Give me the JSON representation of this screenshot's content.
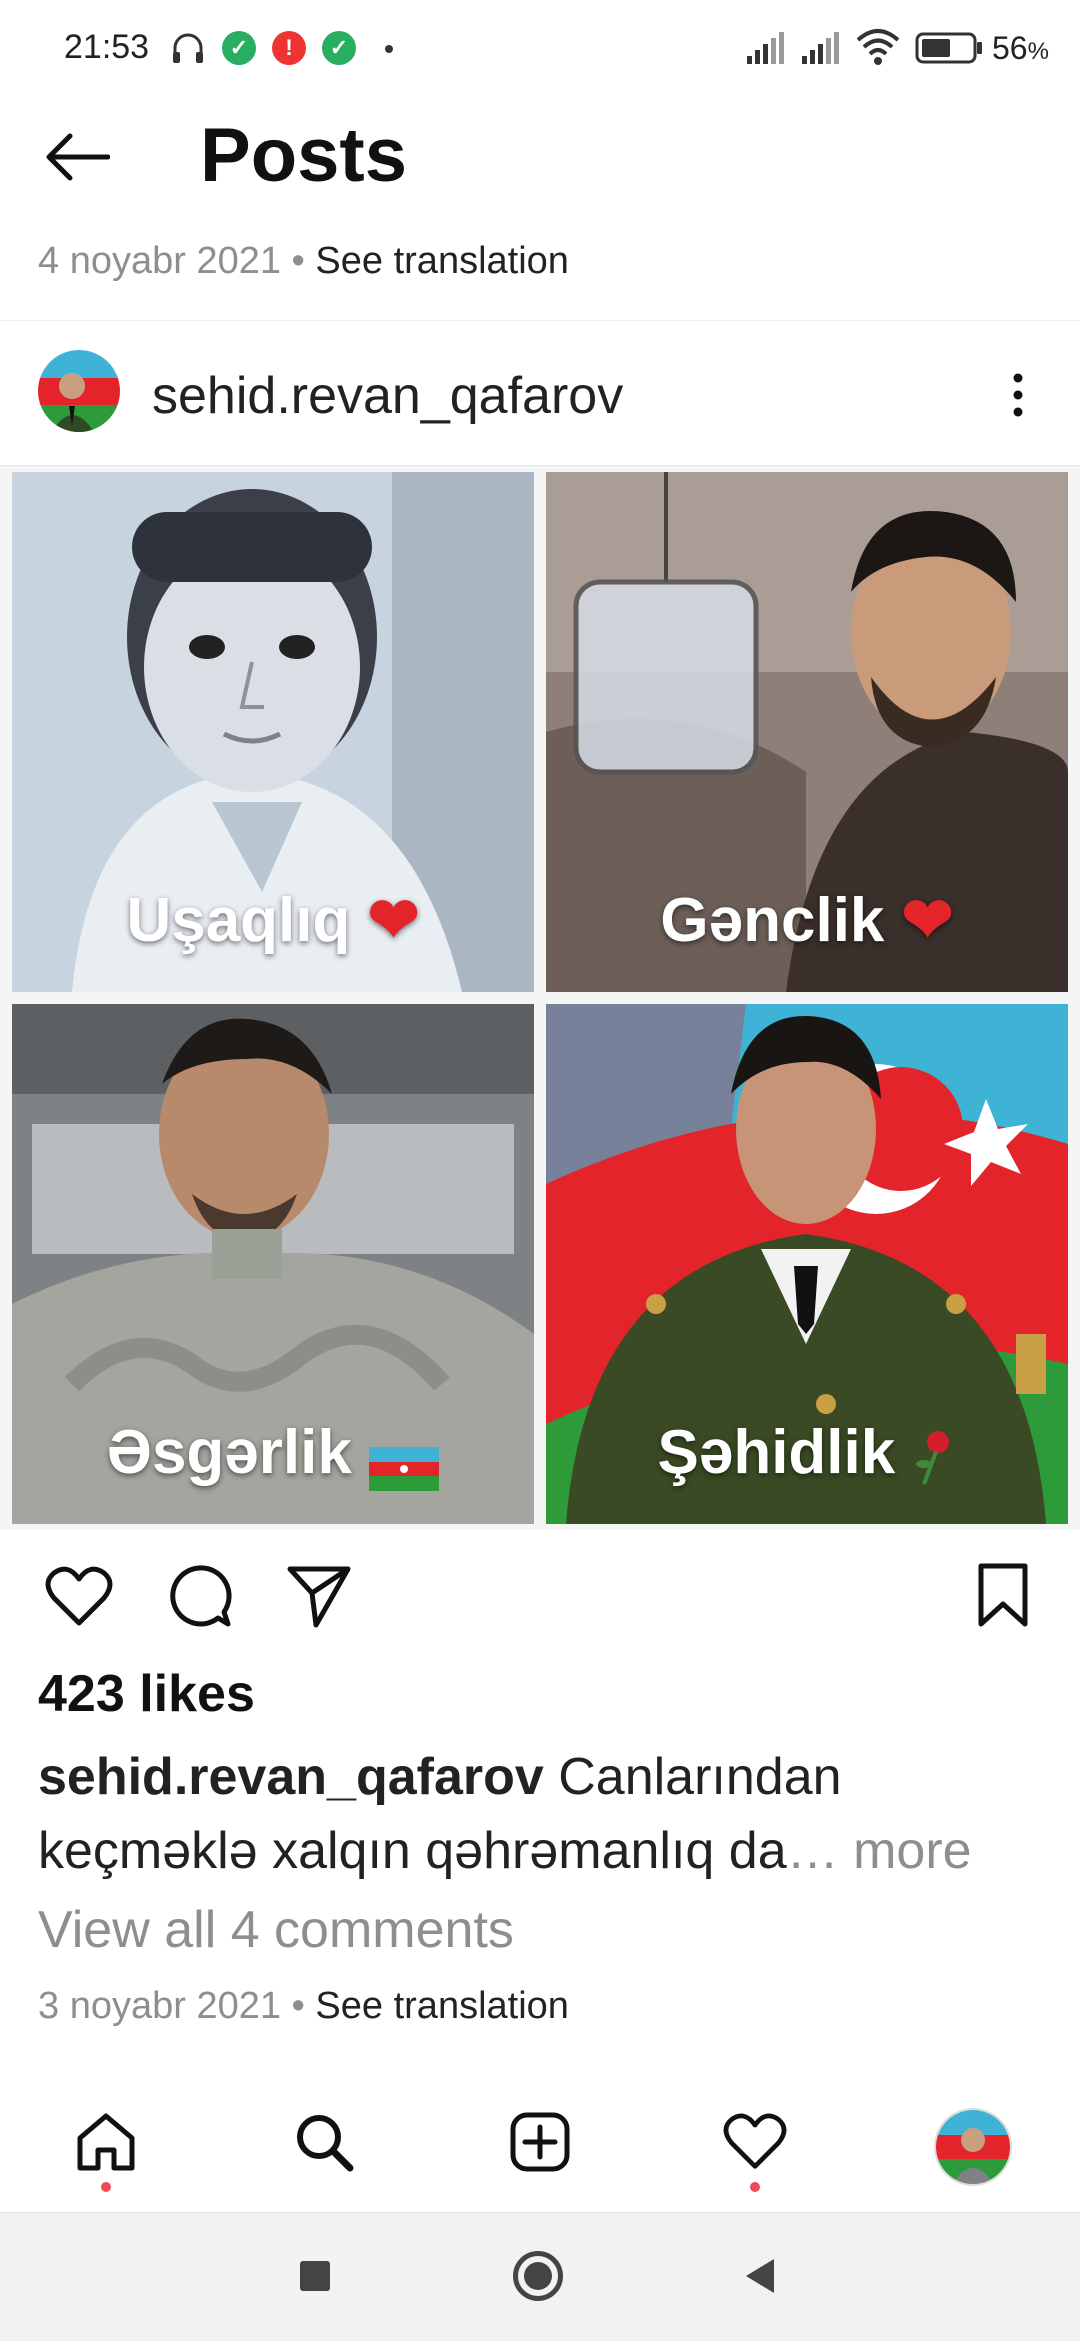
{
  "status_bar": {
    "time": "21:53",
    "battery": "56",
    "battery_unit": "%",
    "icons": [
      "headphones-icon",
      "check-badge-icon",
      "alert-badge-icon",
      "check-badge-icon",
      "dot-icon",
      "signal-icon",
      "signal-icon",
      "wifi-icon",
      "battery-icon"
    ]
  },
  "header": {
    "back_icon": "arrow-left-icon",
    "title": "Posts",
    "date": "4 noyabr 2021",
    "separator": "•",
    "see_translation": "See translation"
  },
  "post": {
    "author": "sehid.revan_qafarov",
    "more_icon": "more-vertical-icon",
    "photos": [
      {
        "caption": "Uşaqlıq",
        "emoji": "❤"
      },
      {
        "caption": "Gənclik",
        "emoji": "❤"
      },
      {
        "caption": "Əsgərlik",
        "emoji": ""
      },
      {
        "caption": "Şəhidlik",
        "emoji": ""
      }
    ],
    "likes": "423 likes",
    "caption_user": "sehid.revan_qafarov",
    "caption_text": "Canlarından keçməklə xalqın qəhrəmanlıq da",
    "caption_more": "… more",
    "view_comments": "View all 4 comments",
    "date": "3 noyabr 2021",
    "separator": "•",
    "see_translation": "See translation"
  },
  "colors": {
    "accent_red": "#ed4956",
    "muted_text": "#8e8e8e",
    "flag_blue": "#3fb3d6",
    "flag_red": "#e3242b",
    "flag_green": "#2d9b3a"
  },
  "bottom_nav": [
    "home-icon",
    "search-icon",
    "new-post-icon",
    "activity-icon",
    "profile-avatar"
  ]
}
